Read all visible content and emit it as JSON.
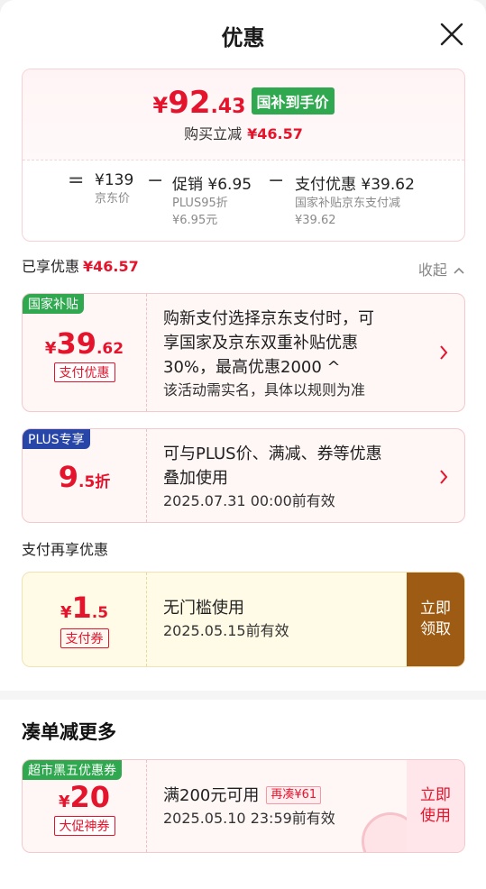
{
  "header": {
    "title": "优惠",
    "close_icon": "close-icon"
  },
  "summary": {
    "price_yen": "¥",
    "price_int": "92",
    "price_dec": ".43",
    "price_badge": "国补到手价",
    "save_label": "购买立减",
    "save_value": "¥46.57",
    "eq": "=",
    "minus": "−",
    "jd_price": "¥139",
    "jd_price_label": "京东价",
    "promo": "促销 ¥6.95",
    "promo_sub1": "PLUS95折",
    "promo_sub2": "¥6.95元",
    "pay": "支付优惠 ¥39.62",
    "pay_sub1": "国家补贴京东支付减",
    "pay_sub2": "¥39.62"
  },
  "enjoyed": {
    "label": "已享优惠",
    "value": "¥46.57",
    "collapse": "收起"
  },
  "coupons": [
    {
      "tag": "国家补贴",
      "yen": "¥",
      "big": "39",
      "small": ".62",
      "pill": "支付优惠",
      "line1": "购新支付选择京东支付时，可",
      "line2": "享国家及京东双重补贴优惠",
      "line3": "30%，最高优惠2000 ^",
      "line4": "该活动需实名，具体以规则为准"
    },
    {
      "tag": "PLUS专享",
      "big": "9",
      "small": ".5折",
      "line1": "可与PLUS价、满减、券等优惠",
      "line2": "叠加使用",
      "line3": "2025.07.31 00:00前有效"
    }
  ],
  "pay_section": {
    "label": "支付再享优惠",
    "yen": "¥",
    "big": "1",
    "small": ".5",
    "pill": "支付券",
    "line1": "无门槛使用",
    "line2": "2025.05.15前有效",
    "claim": "立即领取"
  },
  "more": {
    "title": "凑单减更多",
    "tag": "超市黑五优惠券",
    "yen": "¥",
    "big": "20",
    "pill": "大促神券",
    "line1": "满200元可用",
    "badge": "再凑¥61",
    "line2": "2025.05.10 23:59前有效",
    "use": "立即使用"
  },
  "colors": {
    "accent": "#e4142c",
    "green": "#2fa84f",
    "blue": "#2846a8",
    "brown": "#9e5b13"
  }
}
